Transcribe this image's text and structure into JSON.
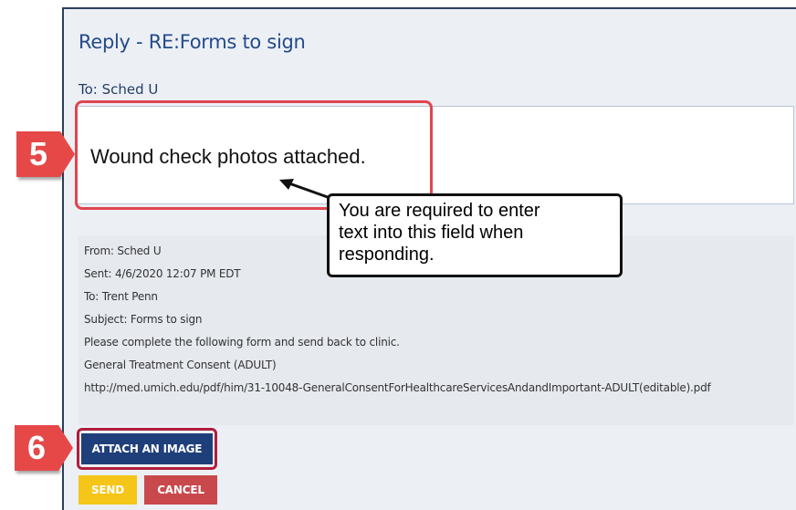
{
  "dialog": {
    "title": "Reply - RE:Forms to sign",
    "to_label": "To: Sched U",
    "reply_text": "Wound check photos attached."
  },
  "callout": {
    "lines": [
      "You are required to enter",
      "text into this field when",
      "responding."
    ]
  },
  "badges": {
    "step5": "5",
    "step6": "6"
  },
  "quoted_message": {
    "from": "From: Sched U",
    "sent": "Sent: 4/6/2020 12:07 PM EDT",
    "to": "To: Trent Penn",
    "subject": "Subject: Forms to sign",
    "body": "Please complete the following form and send back to clinic.",
    "form_name": "General Treatment Consent (ADULT)",
    "link": "http://med.umich.edu/pdf/him/31-10048-GeneralConsentForHealthcareServicesAndandImportant-ADULT(editable).pdf"
  },
  "buttons": {
    "attach": "ATTACH AN IMAGE",
    "send": "SEND",
    "cancel": "CANCEL"
  },
  "colors": {
    "accent": "#244a8a",
    "badge": "#e64848",
    "send": "#f5c518",
    "cancel": "#c9484c",
    "attach": "#1f3f7a"
  },
  "icons": {
    "callout_arrow": "arrow-pointer-icon"
  }
}
